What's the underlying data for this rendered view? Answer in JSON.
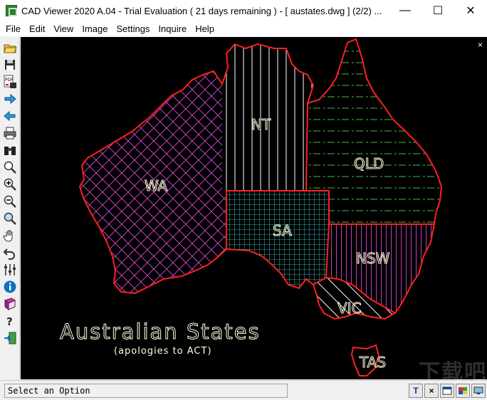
{
  "window": {
    "title": "CAD Viewer 2020 A.04 - Trial Evaluation ( 21 days remaining )  -  [ austates.dwg ] (2/2) ...",
    "minimize_glyph": "—",
    "maximize_glyph": "☐",
    "close_glyph": "✕"
  },
  "menu": [
    "File",
    "Edit",
    "View",
    "Image",
    "Settings",
    "Inquire",
    "Help"
  ],
  "toolbar": {
    "icons": [
      "open-folder-icon",
      "save-icon",
      "export-pdf-icon",
      "next-arrow-icon",
      "previous-arrow-icon",
      "print-icon",
      "binoculars-icon",
      "zoom-icon",
      "zoom-in-icon",
      "zoom-out-icon",
      "zoom-window-icon",
      "pan-hand-icon",
      "undo-icon",
      "layers-icon",
      "info-icon",
      "book-icon",
      "help-icon",
      "exit-icon"
    ]
  },
  "drawing": {
    "colors": {
      "background": "#000000",
      "outline": "#ff2020",
      "wa": "#c040c0",
      "nt": "#ffffff",
      "qld": "#40c040",
      "sa": "#40e0e0",
      "nsw": "#c040c0",
      "vic": "#ffffff",
      "text": "#ffffe0"
    },
    "labels": {
      "wa": "WA",
      "nt": "NT",
      "qld": "QLD",
      "sa": "SA",
      "nsw": "NSW",
      "vic": "VIC",
      "tas": "TAS"
    },
    "title": "Australian States",
    "subtitle": "(apologies to ACT)",
    "close_glyph": "×"
  },
  "status": {
    "text": "Select an Option",
    "buttons": [
      "T",
      "×",
      "",
      "",
      ""
    ]
  },
  "watermark": "下载吧"
}
